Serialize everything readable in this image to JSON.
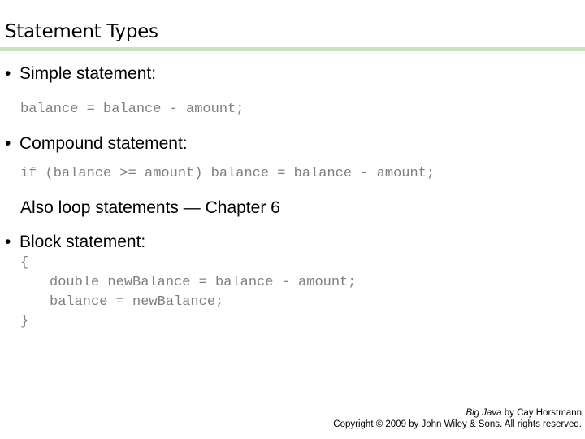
{
  "slide": {
    "title": "Statement Types",
    "bullets": [
      {
        "label": "Simple statement:"
      },
      {
        "label": "Compound statement:"
      },
      {
        "label": "Block statement:"
      }
    ],
    "bullet_glyph": "•",
    "code": {
      "simple": "balance = balance - amount;",
      "compound": "if (balance >= amount) balance = balance - amount;",
      "block_open": "{",
      "block_line1": "double newBalance = balance - amount;",
      "block_line2": "balance = newBalance;",
      "block_close": "}"
    },
    "note": "Also loop statements — Chapter 6"
  },
  "footer": {
    "book_title": "Big Java",
    "author": " by Cay Horstmann",
    "copyright": "Copyright © 2009 by John Wiley & Sons.  All rights reserved."
  },
  "colors": {
    "rule": "#c6e6bd",
    "code": "#808080"
  }
}
